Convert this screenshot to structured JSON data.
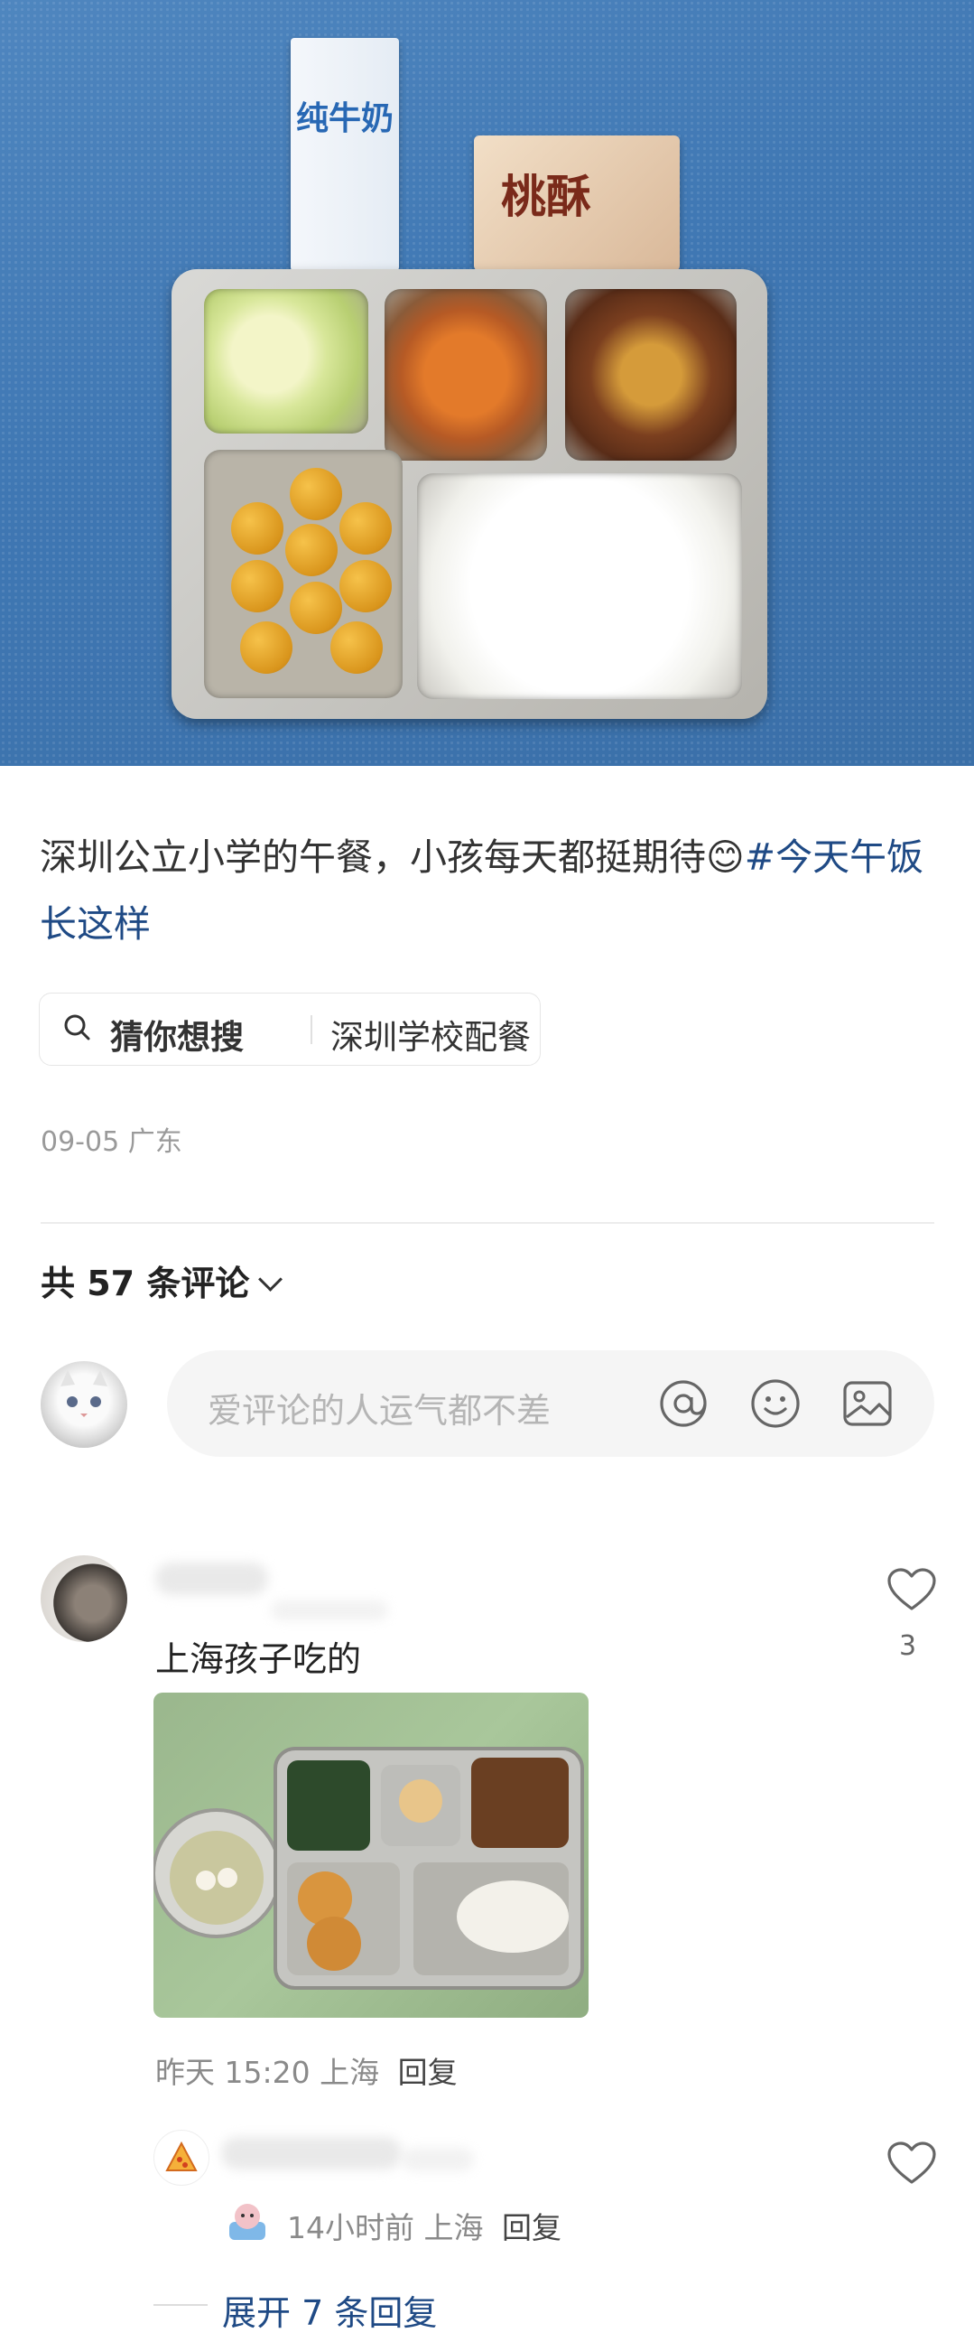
{
  "post": {
    "text": "深圳公立小学的午餐，小孩每天都挺期待😊",
    "hashtag": "#今天午饭长这样",
    "date": "09-05",
    "location": "广东"
  },
  "photo": {
    "milk_label": "纯牛奶",
    "snack_label": "桃酥"
  },
  "search": {
    "label": "猜你想搜",
    "query": "深圳学校配餐"
  },
  "comments_header": {
    "label": "共 57 条评论"
  },
  "compose": {
    "placeholder": "爱评论的人运气都不差"
  },
  "comments": [
    {
      "text": "上海孩子吃的",
      "time": "昨天 15:20",
      "location": "上海",
      "reply_label": "回复",
      "likes": "3"
    },
    {
      "time": "14小时前",
      "location": "上海",
      "reply_label": "回复"
    }
  ],
  "expand_replies": "展开 7 条回复",
  "colors": {
    "accent": "#1f4a85",
    "muted": "#9a9a9a",
    "input_bg": "#f5f5f5"
  },
  "icons": [
    "search-icon",
    "chevron-down-icon",
    "at-icon",
    "emoji-icon",
    "image-icon",
    "heart-icon"
  ]
}
